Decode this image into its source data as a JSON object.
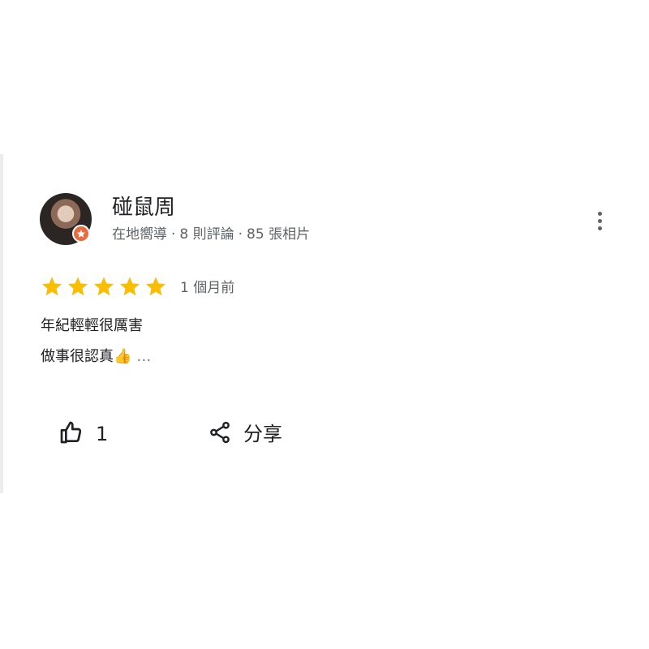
{
  "reviewer": {
    "name": "碰鼠周",
    "role": "在地嚮導",
    "separator": "·",
    "reviews": "8 則評論",
    "photos": "85 張相片",
    "badge_icon": "star-badge-icon",
    "badge_color": "#ea6a3f"
  },
  "review": {
    "rating": 5,
    "star_color": "#fbbc04",
    "time": "1 個月前",
    "lines": [
      "年紀輕輕很厲害",
      "做事很認真👍"
    ],
    "more": "…"
  },
  "actions": {
    "like_count": "1",
    "share_label": "分享"
  },
  "icons": {
    "like": "thumbs-up-icon",
    "share": "share-icon",
    "menu": "more-vert-icon"
  }
}
